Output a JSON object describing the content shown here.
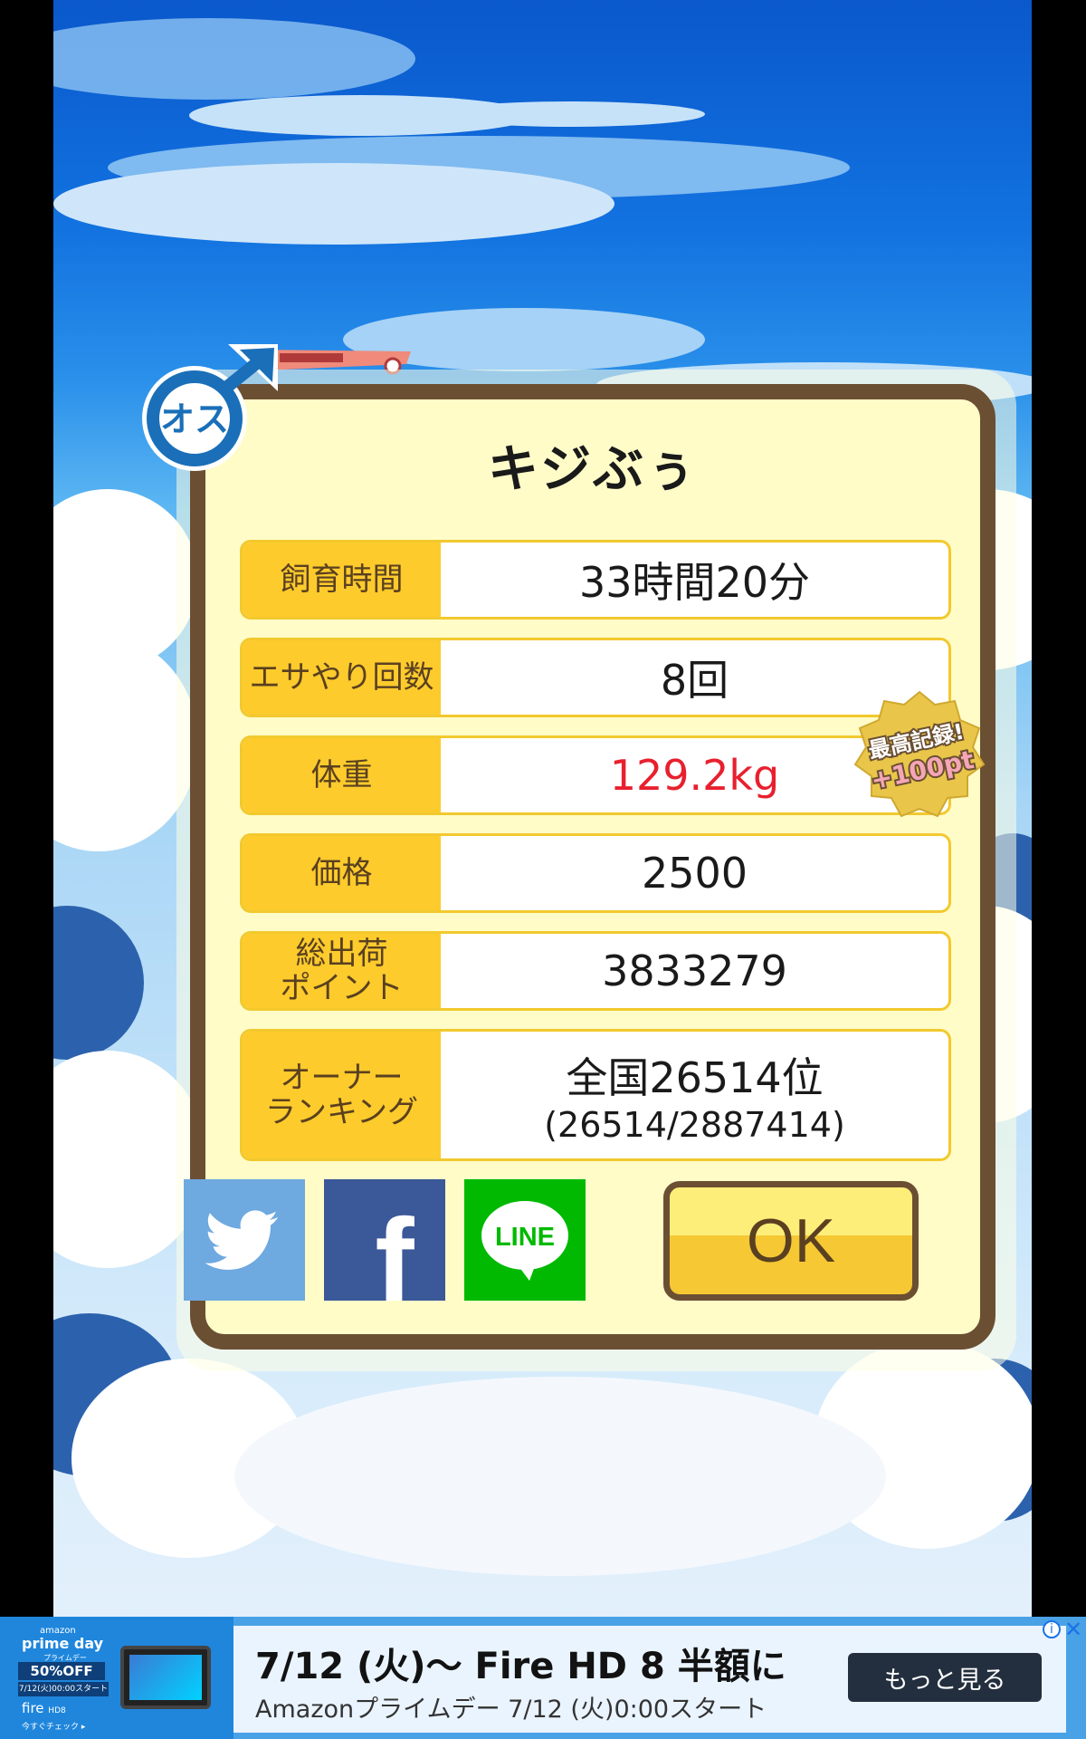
{
  "dialog": {
    "title": "キジぶぅ",
    "gender_label": "オス",
    "rows": [
      {
        "label": "飼育時間",
        "value": "33時間20分"
      },
      {
        "label": "エサやり回数",
        "value": "8回"
      },
      {
        "label": "体重",
        "value": "129.2kg",
        "highlight_color": "#e8202e"
      },
      {
        "label": "価格",
        "value": "2500"
      },
      {
        "label": "総出荷\nポイント",
        "value": "3833279"
      },
      {
        "label": "オーナー\nランキング",
        "value": "全国26514位",
        "sub_value": "(26514/2887414)"
      }
    ],
    "record_badge": {
      "line1": "最高記録!",
      "line2": "+100pt"
    },
    "share": {
      "twitter_icon": "twitter-bird-icon",
      "facebook_letter": "f",
      "line_label": "LINE"
    },
    "ok_label": "OK"
  },
  "ad": {
    "brand_top": "amazon",
    "brand": "prime day",
    "brand_sub": "プライムデー",
    "discount": "50%OFF",
    "date_small": "7/12(火)00:00スタート",
    "product": "fire",
    "product_model": "HD8",
    "check": "今すぐチェック ▸",
    "headline": "7/12 (火)〜 Fire HD 8 半額に",
    "subline": "Amazonプライムデー 7/12 (火)0:00スタート",
    "cta": "もっと見る",
    "info": "i",
    "close": "✕"
  },
  "colors": {
    "frame": "#6b4f33",
    "panel": "#fffcc8",
    "label_bg": "#fdcb2c",
    "twitter": "#6ea9e0",
    "facebook": "#3b5998",
    "line": "#00b900"
  }
}
